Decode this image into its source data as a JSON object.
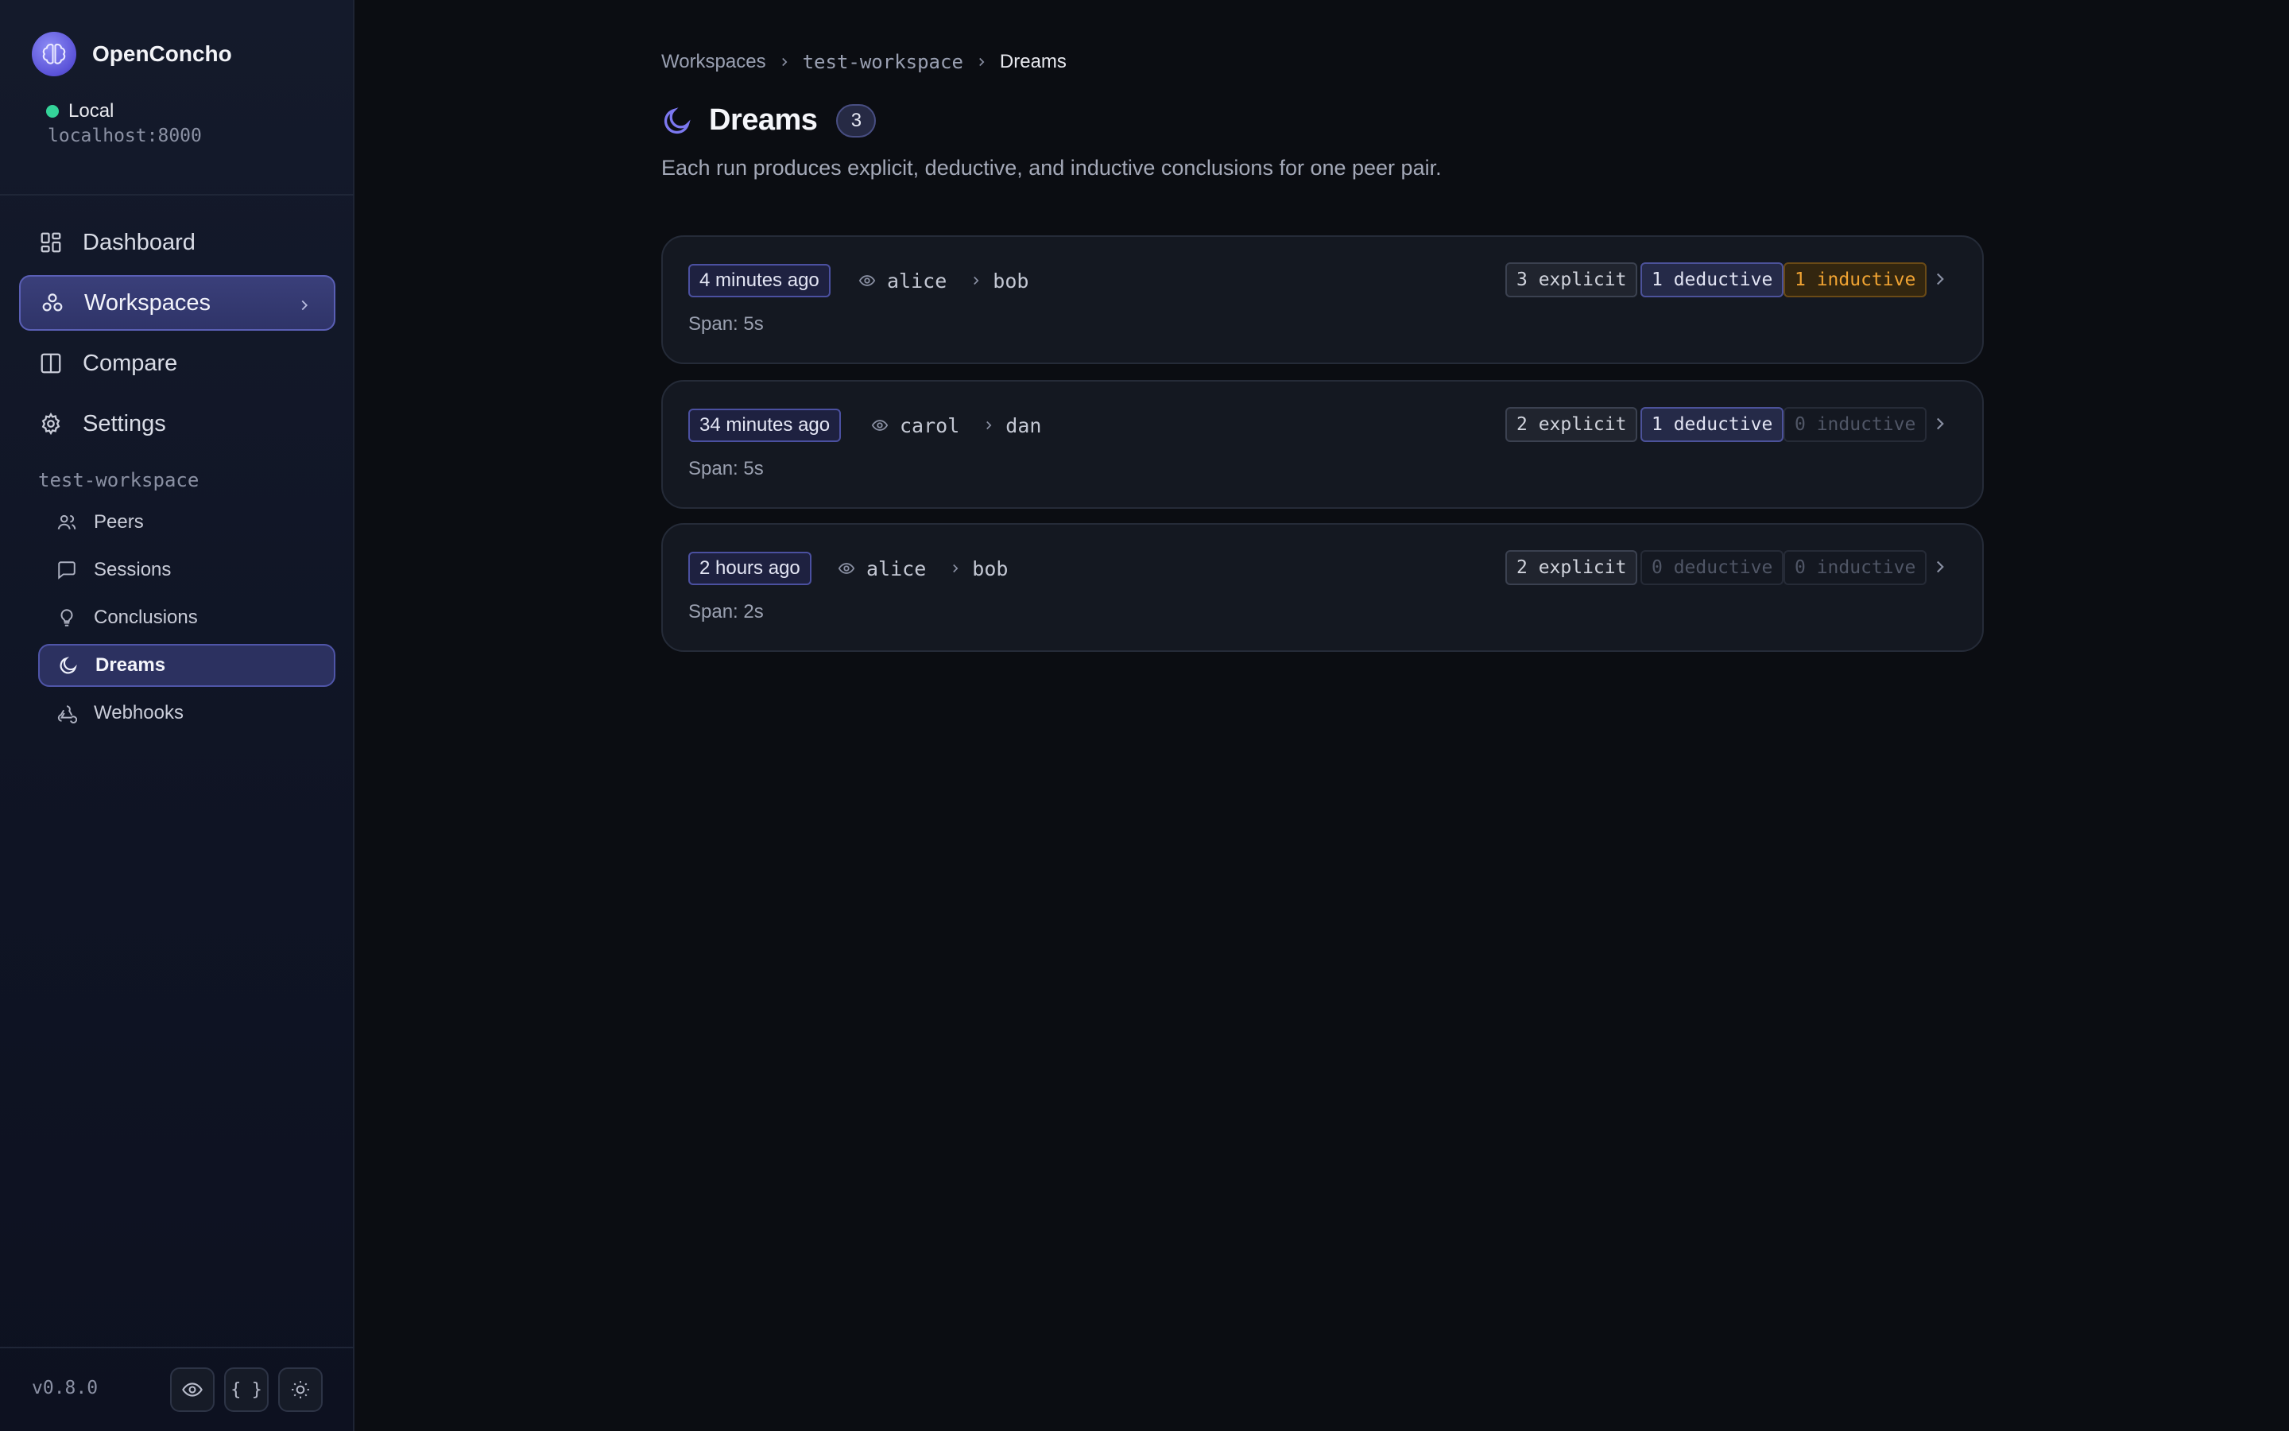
{
  "app": {
    "name": "OpenConcho",
    "env_label": "Local",
    "host": "localhost:8000",
    "version": "v0.8.0"
  },
  "nav": {
    "dashboard": "Dashboard",
    "workspaces": "Workspaces",
    "compare": "Compare",
    "settings": "Settings"
  },
  "workspace": {
    "name": "test-workspace",
    "items": {
      "peers": "Peers",
      "sessions": "Sessions",
      "conclusions": "Conclusions",
      "dreams": "Dreams",
      "webhooks": "Webhooks"
    }
  },
  "breadcrumb": {
    "root": "Workspaces",
    "workspace": "test-workspace",
    "current": "Dreams"
  },
  "page": {
    "title": "Dreams",
    "count": "3",
    "subtitle": "Each run produces explicit, deductive, and inductive conclusions for one peer pair."
  },
  "dreams": [
    {
      "time": "4 minutes ago",
      "observer": "alice",
      "observed": "bob",
      "span": "Span: 5s",
      "explicit": "3 explicit",
      "deductive": "1 deductive",
      "inductive": "1 inductive",
      "explicit_active": true,
      "deductive_active": true,
      "inductive_active": true
    },
    {
      "time": "34 minutes ago",
      "observer": "carol",
      "observed": "dan",
      "span": "Span: 5s",
      "explicit": "2 explicit",
      "deductive": "1 deductive",
      "inductive": "0 inductive",
      "explicit_active": true,
      "deductive_active": true,
      "inductive_active": false
    },
    {
      "time": "2 hours ago",
      "observer": "alice",
      "observed": "bob",
      "span": "Span: 2s",
      "explicit": "2 explicit",
      "deductive": "0 deductive",
      "inductive": "0 inductive",
      "explicit_active": true,
      "deductive_active": false,
      "inductive_active": false
    }
  ],
  "footer_buttons": {
    "json_label": "{ }"
  },
  "colors": {
    "accent": "#5a5fb5",
    "status_online": "#34d399",
    "inductive": "#f0a332"
  }
}
